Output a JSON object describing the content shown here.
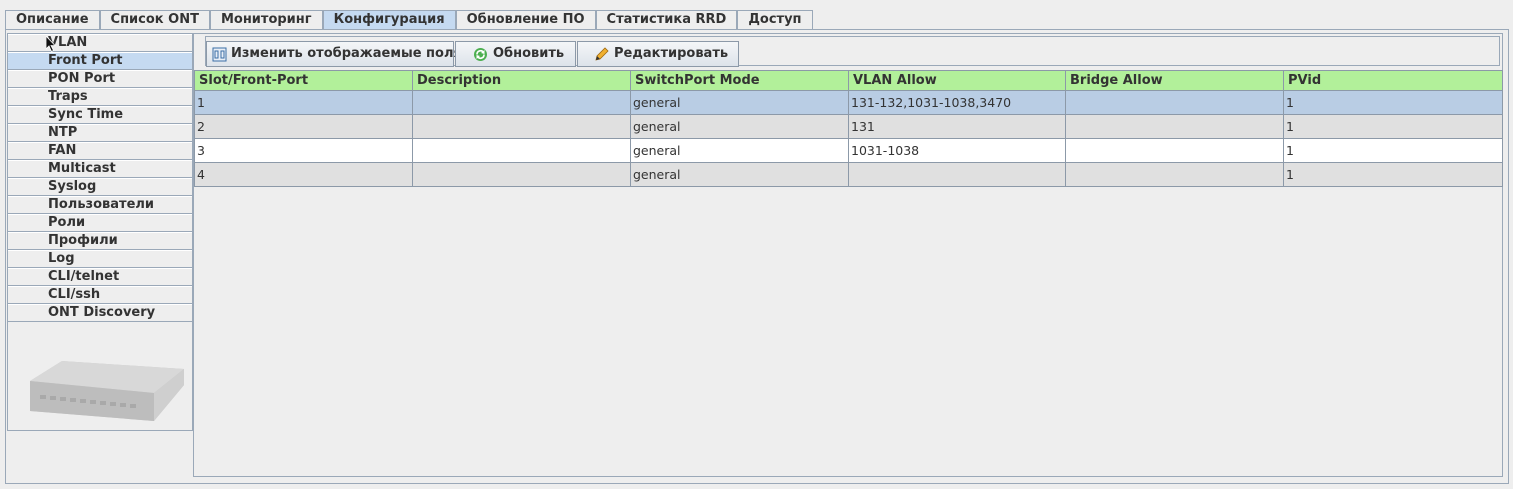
{
  "tabs": [
    {
      "label": "Описание",
      "active": false
    },
    {
      "label": "Список ONT",
      "active": false
    },
    {
      "label": "Мониторинг",
      "active": false
    },
    {
      "label": "Конфигурация",
      "active": true
    },
    {
      "label": "Обновление ПО",
      "active": false
    },
    {
      "label": "Статистика RRD",
      "active": false
    },
    {
      "label": "Доступ",
      "active": false
    }
  ],
  "sidebar": {
    "items": [
      {
        "label": "VLAN"
      },
      {
        "label": "Front Port"
      },
      {
        "label": "PON Port"
      },
      {
        "label": "Traps"
      },
      {
        "label": "Sync Time"
      },
      {
        "label": "NTP"
      },
      {
        "label": "FAN"
      },
      {
        "label": "Multicast"
      },
      {
        "label": "Syslog"
      },
      {
        "label": "Пользователи"
      },
      {
        "label": "Роли"
      },
      {
        "label": "Профили"
      },
      {
        "label": "Log"
      },
      {
        "label": "CLI/telnet"
      },
      {
        "label": "CLI/ssh"
      },
      {
        "label": "ONT Discovery"
      }
    ],
    "selected_index": 1
  },
  "toolbar": {
    "change_fields_label": "Изменить отображаемые поля",
    "refresh_label": "Обновить",
    "edit_label": "Редактировать"
  },
  "table": {
    "columns": [
      "Slot/Front-Port",
      "Description",
      "SwitchPort Mode",
      "VLAN Allow",
      "Bridge Allow",
      "PVid"
    ],
    "rows": [
      {
        "slot": "1",
        "description": "",
        "mode": "general",
        "vlan_allow": "131-132,1031-1038,3470",
        "bridge_allow": "",
        "pvid": "1"
      },
      {
        "slot": "2",
        "description": "",
        "mode": "general",
        "vlan_allow": "131",
        "bridge_allow": "",
        "pvid": "1"
      },
      {
        "slot": "3",
        "description": "",
        "mode": "general",
        "vlan_allow": "1031-1038",
        "bridge_allow": "",
        "pvid": "1"
      },
      {
        "slot": "4",
        "description": "",
        "mode": "general",
        "vlan_allow": "",
        "bridge_allow": "",
        "pvid": "1"
      }
    ],
    "selected_row": 0
  },
  "colors": {
    "header_bg": "#b2f09a",
    "selection": "#b9cde4",
    "active_tab": "#c5daf1"
  }
}
